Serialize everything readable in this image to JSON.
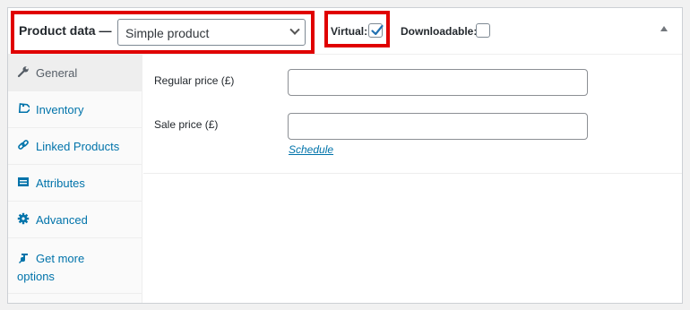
{
  "header": {
    "title": "Product data —",
    "product_type": "Simple product",
    "virtual_label": "Virtual:",
    "virtual_checked": true,
    "downloadable_label": "Downloadable:",
    "downloadable_checked": false,
    "highlight_color": "#e00000"
  },
  "tabs": [
    {
      "label": "General",
      "icon": "wrench-icon",
      "active": true
    },
    {
      "label": "Inventory",
      "icon": "tag-icon",
      "active": false
    },
    {
      "label": "Linked Products",
      "icon": "link-icon",
      "active": false
    },
    {
      "label": "Attributes",
      "icon": "list-icon",
      "active": false
    },
    {
      "label": "Advanced",
      "icon": "gear-icon",
      "active": false
    },
    {
      "label": "Get more options",
      "icon": "plugin-icon",
      "active": false
    }
  ],
  "general": {
    "regular_price_label": "Regular price (£)",
    "regular_price_value": "",
    "sale_price_label": "Sale price (£)",
    "sale_price_value": "",
    "schedule_link": "Schedule"
  },
  "colors": {
    "link": "#0073aa",
    "active_tab_text": "#555d66",
    "checkbox_check": "#2271b1"
  }
}
